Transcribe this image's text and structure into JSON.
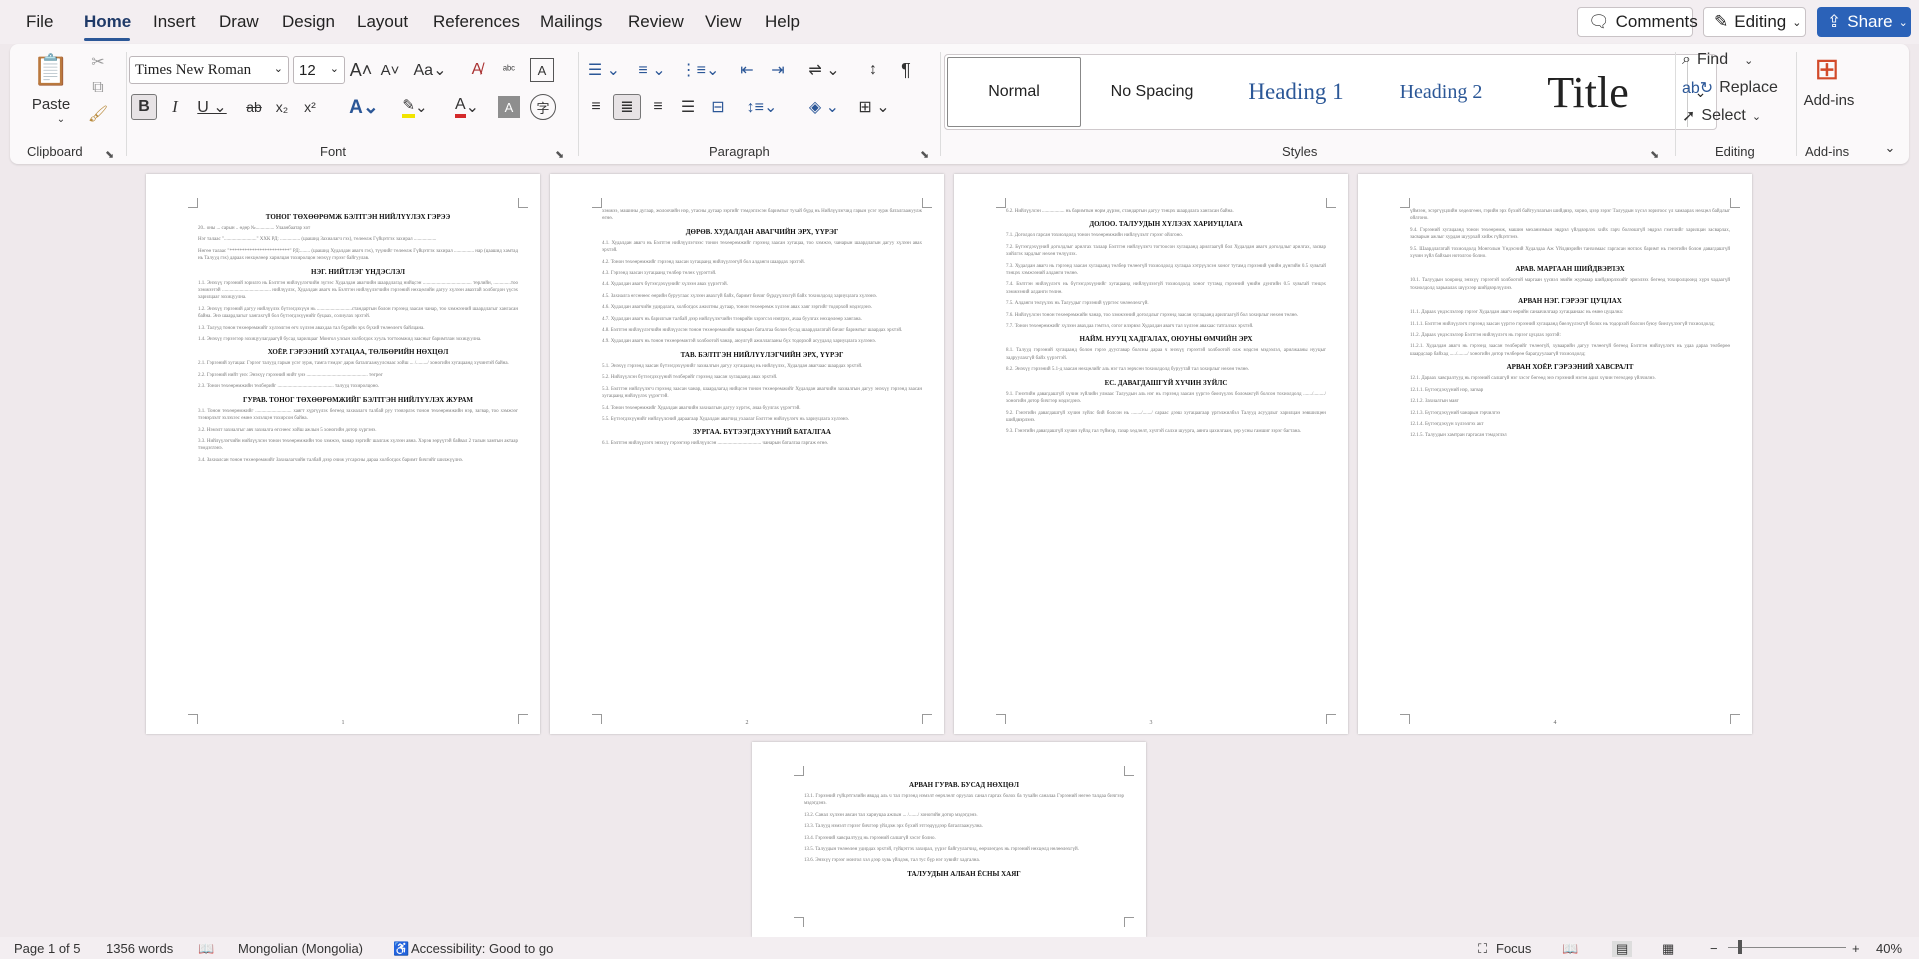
{
  "menu": {
    "tabs": [
      "File",
      "Home",
      "Insert",
      "Draw",
      "Design",
      "Layout",
      "References",
      "Mailings",
      "Review",
      "View",
      "Help"
    ],
    "active": "Home"
  },
  "topright": {
    "comments": "Comments",
    "editing": "Editing",
    "share": "Share"
  },
  "ribbon": {
    "clipboard": {
      "label": "Clipboard",
      "paste": "Paste"
    },
    "font": {
      "label": "Font",
      "name": "Times New Roman",
      "size": "12"
    },
    "paragraph": {
      "label": "Paragraph"
    },
    "styles": {
      "label": "Styles",
      "items": [
        "Normal",
        "No Spacing",
        "Heading 1",
        "Heading 2",
        "Title"
      ]
    },
    "editing": {
      "label": "Editing",
      "find": "Find",
      "replace": "Replace",
      "select": "Select"
    },
    "addins": {
      "label": "Add-ins",
      "button": "Add-ins"
    }
  },
  "pages": [
    {
      "num": "1",
      "blocks": [
        {
          "t": "h",
          "v": "ТОНОГ ТӨХӨӨРӨМЖ БЭЛТГЭН НИЙЛҮҮЛЭХ ГЭРЭЭ"
        },
        {
          "t": "p",
          "v": "20.. оны ... сарын .. өдөр                    №...............                                          Улаанбаатар хот"
        },
        {
          "t": "p",
          "v": "Нэг талаас \"..........................\" ХХК РД: ................ (цаашид Захиалагч гэх), төлөөлж Гүйцэтгэх захирал .................."
        },
        {
          "t": "p",
          "v": "Нөгөө талаас \"************************\" РД:........ (цаашид Худалдан авагч гэх), түүнийг төлөөлж Гүйцэтгэх захирал ................ нар (цаашид хамтад нь Талууд гэх) дараах нөхцөлөөр харилцан тохиролцон энэхүү гэрээг байгуулав."
        },
        {
          "t": "h",
          "v": "НЭГ. НИЙТЛЭГ ҮНДЭСЛЭЛ"
        },
        {
          "t": "p",
          "v": "1.1. Энэхүү гэрээний зорилго нь Бэлтгэн нийлүүлэгчийн зүгээс Худалдан авагчийн шаардлагад нийцсэн ....................................... төрлийн, ..............тоо хэмжээтэй ....................................... нийлүүлэх, Худалдан авагч нь Бэлтгэн нийлүүлэгчийн гэрээний нөхцөлийн дагуу хүлээн авахтай холбогдон үүсэх харилцааг зохицуулна."
        },
        {
          "t": "p",
          "v": "1.2. Энэхүү гэрээний дагуу нийлүүлэх бүтээгдэхүүн нь ............................стандартын болон гэрээнд заасан чанар, тоо хэмжээний шаардлагыг хангасан байна. Энэ шаардлагыг хангахгүй бол бүтээгдэхүүнийг буцаах, солиулах эрхтэй."
        },
        {
          "t": "p",
          "v": "1.3. Талууд тонон төхөөрөмжийг хүлээлгэн өгч хүлээн авахдаа тал бүрийн эрх бүхий төлөөлөгч байлцана."
        },
        {
          "t": "p",
          "v": "1.4. Энэхүү гэрээгээр зохицуулагдаагүй бусад харилцааг Монгол улсын холбогдох хууль тогтоомжид заасныг баримтлан зохицуулна."
        },
        {
          "t": "h",
          "v": "ХОЁР. ГЭРЭЭНИЙ ХУГАЦАА, ТӨЛБӨРИЙН НӨХЦӨЛ"
        },
        {
          "t": "p",
          "v": "2.1. Гэрээний хугацаа: Гэрээг талууд гарын үсэг зурж, тамга тэмдэг дарж баталгаажуулснаас хойш ... /........./ хоногийн хугацаанд хүчинтэй байна."
        },
        {
          "t": "p",
          "v": "2.2. Гэрээний нийт үнэ: Энэхүү гэрээний нийт үнэ ................................................. төгрөг"
        },
        {
          "t": "p",
          "v": "2.3. Тонон төхөөрөмжийн төлбөрийг ............................................. талууд тохиролцоно."
        },
        {
          "t": "h",
          "v": "ГУРАВ. ТОНОГ ТӨХӨӨРӨМЖИЙГ БЭЛТГЭН НИЙЛҮҮЛЭХ ЖУРАМ"
        },
        {
          "t": "p",
          "v": "3.1. Тонон төхөөрөмжийг ............................. хаягт хүргүүлэх бөгөөд захиалагч талбай руу тээвэрлэх тонон төхөөрөмжийн нэр, загвар, тоо хэмжээг тээвэрлэлт эхлэхээс өмнө хэлэлцэн тохирсон байна."
        },
        {
          "t": "p",
          "v": "3.2. Нэмэлт захиалгыг авч захиалга өгснөөс хойш ажлын 5 хоногийн дотор хүргэнэ."
        },
        {
          "t": "p",
          "v": "3.3. Нийлүүлэгчийн нийлүүлсэн тонон төхөөрөмжийн тоо хэмжээ, чанар зэргийг шалгаж хүлээн авна. Хэрэв зөрүүтэй байвал 2 талын хамтын актаар тэмдэглэнэ."
        },
        {
          "t": "p",
          "v": "3.4. Захиалсан тонон төхөөрөмжийг Захиалагчийн талбай дээр очиж угсарсны дараа холбогдох баримт бичгийг шилжүүлнэ."
        }
      ]
    },
    {
      "num": "2",
      "blocks": [
        {
          "t": "p",
          "v": "хэмжээ, машины дугаар, жолоочийн нэр, утасны дугаар зэргийг тэмдэглэсэн баримтыг тухай бүрд нь Нийлүүлэгчид гарын үсэг зурж баталгаажуулж өгнө."
        },
        {
          "t": "h",
          "v": "ДӨРӨВ. ХУДАЛДАН АВАГЧИЙН ЭРХ, ҮҮРЭГ"
        },
        {
          "t": "p",
          "v": "4.1. Худалдан авагч нь Бэлтгэн нийлүүлэгчээс тонон төхөөрөмжийг гэрээнд заасан хугацаа, тоо хэмжээ, чанарын шаардлагын дагуу хүлээн авах эрхтэй."
        },
        {
          "t": "p",
          "v": "4.2. Тонон төхөөрөмжийг гэрээнд заасан хугацаанд нийлүүлээгүй бол алданги шаардах эрхтэй."
        },
        {
          "t": "p",
          "v": "4.3. Гэрээнд заасан хугацаанд төлбөр төлөх үүрэгтэй."
        },
        {
          "t": "p",
          "v": "4.4. Худалдан авагч бүтээгдэхүүнийг хүлээн авах үүрэгтэй."
        },
        {
          "t": "p",
          "v": "4.5. Захиалга өгсөнөөс өөрийн буруугаас хүлээн авахгүй байх, баримт бичиг бүрдүүлэхгүй байх тохиолдолд хариуцлага хүлээнэ."
        },
        {
          "t": "p",
          "v": "4.6. Худалдан авагчийн удирдлага, холбогдох ажилтны дугаар, тонон төхөөрөмж хүлээн авах хаяг зэргийг тодорхой мэдэгдэнэ."
        },
        {
          "t": "p",
          "v": "4.7. Худалдан авагч нь барилгын талбай дээр нийлүүлэгчийн тээврийн хэрэгсэл нэвтрэх, ачаа буулгах нөхцөлөөр хангана."
        },
        {
          "t": "p",
          "v": "4.8. Бэлтгэн нийлүүлэгчийн нийлүүлсэн тонон төхөөрөмжийн чанарын баталгаа болон бусад шаардлагатай бичиг баримтыг шаардах эрхтэй."
        },
        {
          "t": "p",
          "v": "4.9. Худалдан авагч нь тонон төхөөрөмжтэй холбоотой чанар, аюулгүй ажиллагааны бүх тодорхой асуудалд хариуцлага хүлээнэ."
        },
        {
          "t": "h",
          "v": "ТАВ. БЭЛТГЭН НИЙЛҮҮЛЭГЧИЙН ЭРХ, ҮҮРЭГ"
        },
        {
          "t": "p",
          "v": "5.1. Энэхүү гэрээнд заасан бүтээгдэхүүнийг захиалгын дагуу хугацаанд нь нийлүүлэх, Худалдан авагчаас шаардах эрхтэй."
        },
        {
          "t": "p",
          "v": "5.2. Нийлүүлсэн бүтээгдэхүүний төлбөрийг гэрээнд заасан хугацаанд авах эрхтэй."
        },
        {
          "t": "p",
          "v": "5.3. Бэлтгэн нийлүүлэгч гэрээнд заасан чанар, шаардлагад нийцсэн тонон төхөөрөмжийг Худалдан авагчийн захиалгын дагуу энэхүү гэрээнд заасан хугацаанд нийлүүлэх үүрэгтэй."
        },
        {
          "t": "p",
          "v": "5.4. Тонон төхөөрөмжийг Худалдан авагчийн захиалгын дагуу хүргэх, ачаа буулгах үүрэгтэй."
        },
        {
          "t": "p",
          "v": "5.5. Бүтээгдэхүүнийг нийлүүлсний дараагаар Худалдан авагчид ухаалаг Бэлтгэн нийлүүлэгч нь хариуцлага хүлээнэ."
        },
        {
          "t": "h",
          "v": "ЗУРГАА. БҮТЭЭГДЭХҮҮНИЙ БАТАЛГАА"
        },
        {
          "t": "p",
          "v": "6.1. Бэлтгэн нийлүүлэгч энэхүү гэрээгээр нийлүүлсэн ................................... чанарын баталгаа гаргаж өгнө."
        }
      ]
    },
    {
      "num": "3",
      "blocks": [
        {
          "t": "p",
          "v": "6.2. Нийлүүлсэн .................. нь баримтын норм дүрэм, стандартын дагуу тэнцэх шаардлага хангасан байна."
        },
        {
          "t": "h",
          "v": "ДОЛОО. ТАЛУУДЫН ХҮЛЭЭХ ХАРИУЦЛАГА"
        },
        {
          "t": "p",
          "v": "7.1. Доголдол гарсан тохиолдолд тонон төхөөрөмжийн нийлүүлэлт гэрээг ойлгоно."
        },
        {
          "t": "p",
          "v": "7.2. Бүтээгдэхүүний доголдлыг арилгах талаар Бэлтгэн нийлүүлэгч тогтоосон хугацаанд арилгаагүй бол Худалдан авагч доголдлыг арилгах, засвар хийлгэх зардлыг нөхөн төлүүлэх."
        },
        {
          "t": "p",
          "v": "7.3. Худалдан авагч нь гэрээнд заасан хугацаанд төлбөр төлөөгүй тохиолдолд хугацаа хэтрүүлсэн хоног тутамд гэрээний үнийн дүнгийн 0.5 хувьтай тэнцэх хэмжээний алданги төлнө."
        },
        {
          "t": "p",
          "v": "7.4. Бэлтгэн нийлүүлэгч нь бүтээгдэхүүнийг хугацаанд нийлүүлээгүй тохиолдолд хоног тутамд гэрээний үнийн дүнгийн 0.5 хувьтай тэнцэх хэмжээний алданги төлнө."
        },
        {
          "t": "p",
          "v": "7.5. Алданги төлүүлэх нь Талуудыг гэрээний үүргээс чөлөөлөхгүй."
        },
        {
          "t": "p",
          "v": "7.6. Нийлүүлсэн тонон төхөөрөмжийн чанар, тоо хэмжээний доголдлыг гэрээнд заасан хугацаанд арилгаагүй бол хохирлыг нөхөн төлнө."
        },
        {
          "t": "p",
          "v": "7.7. Тонон төхөөрөмжийг хүлээн авахдаа гэмтэл, согог илэрвэл Худалдан авагч тал хүлээн авахаас татгалзах эрхтэй."
        },
        {
          "t": "h",
          "v": "НАЙМ. НУУЦ ХАДГАЛАХ, ОЮУНЫ ӨМЧИЙН ЭРХ"
        },
        {
          "t": "p",
          "v": "8.1. Талууд гэрээний хугацаанд болон гэрээ дуусгавар болсны дараа ч энэхүү гэрээтэй холбоотой олж мэдсэн мэдээлэл, арилжааны нууцыг задруулахгүй байх үүрэгтэй."
        },
        {
          "t": "p",
          "v": "8.2. Энэхүү гэрээний 5.1-д заасан нөхцөлийг аль нэг тал зөрчсөн тохиолдолд буруутай тал хохирлыг нөхөн төлнө."
        },
        {
          "t": "h",
          "v": "ЕС. ДАВАГДАШГҮЙ ХҮЧИН ЗҮЙЛС"
        },
        {
          "t": "p",
          "v": "9.1. Гэнэтийн давагдашгүй хүчин зүйлийн улмаас Талуудын аль нэг нь гэрээнд заасан үүргээ биелүүлэх боломжгүй болсон тохиолдолд ......./........./ хоногийн дотор бичгээр мэдэгдэнэ."
        },
        {
          "t": "p",
          "v": "9.2. Гэнэтийн давагдашгүй хүчин зүйлс бий болсон нь ......../......./ сараас дээш хугацаагаар үргэлжилбэл Талууд асуудлыг харилцан зөвшилцөн шийдвэрлэнэ."
        },
        {
          "t": "p",
          "v": "9.3. Гэнэтийн давагдашгүй хүчин зүйлд гал түймэр, газар хөдлөлт, хүчтэй салхи шуурга, аянга цахилгаан, үер усны гамшиг зэрэг багтана."
        }
      ]
    },
    {
      "num": "4",
      "blocks": [
        {
          "t": "p",
          "v": "үймээн, эсэргүүцлийн хөдөлгөөн, гэрийн эрх бүхий байгууллагын шийдвэр, хорио, цээр зэрэг Талуудын хүсэл зоригоос үл хамаарах нөхцөл байдлыг ойлгоно."
        },
        {
          "t": "p",
          "v": "9.4. Гэрээний хугацаанд тонон төхөөрөмж, машин механизмын эвдрэл үйлдвэрлэх хийх гарч болзошгүй эвдрэл гэмтлийг харилцан засварлах, засварын ажлыг хурдан шуурхай хийж гүйцэтгэнэ."
        },
        {
          "t": "p",
          "v": "9.5. Шаардлагатай тохиолдолд Монголын Үндэсний Худалдаа Аж Үйлдвэрийн танхимаас гаргасан нотлох баримт нь гэнэтийн болон давагдашгүй хүчин зүйл байхын нотолгоо болно."
        },
        {
          "t": "h",
          "v": "АРАВ. МАРГААН ШИЙДВЭРЛЭХ"
        },
        {
          "t": "p",
          "v": "10.1. Талуудын хооронд энэхүү гэрээтэй холбоотой маргаан үүсвэл эвийн журмаар шийдвэрлэхийг эрмэлзэх бөгөөд тохиролцоонд хүрч чадаагүй тохиолдолд харьяалах шүүхээр шийдвэрлүүлнэ."
        },
        {
          "t": "h",
          "v": "АРВАН НЭГ. ГЭРЭЭГ ЦУЦЛАХ"
        },
        {
          "t": "p",
          "v": "11.1. Дараах үндэслэлээр гэрээг Худалдан авагч өөрийн санаачилгаар хугацаанаас нь өмнө цуцална:"
        },
        {
          "t": "p",
          "v": "11.1.1. Бэлтгэн нийлүүлэгч гэрээнд заасан үүргээ гэрээний хугацаанд биелүүлэхгүй болох нь тодорхой болсон буюу биелүүлээгүй тохиолдолд;"
        },
        {
          "t": "p",
          "v": "11.2. Дараах үндэслэлээр Бэлтгэн нийлүүлэгч нь гэрээг цуцлах эрхтэй:"
        },
        {
          "t": "p",
          "v": "11.2.1. Худалдан авагч нь гэрээнд заасан төлбөрийг төлөөгүй, хуваарийн дагуу төлөөгүй бөгөөд Бэлтгэн нийлүүлэгч нь удаа дараа төлбөрөө шаардсаар байхад ...../......../ хоногийн дотор төлбөрөө барагдуулаагүй тохиолдолд;"
        },
        {
          "t": "h",
          "v": "АРВАН ХОЁР. ГЭРЭЭНИЙ ХАВСРАЛТ"
        },
        {
          "t": "p",
          "v": "12.1. Дараах хавсралтууд нь гэрээний салшгүй нэг хэсэг бөгөөд энэ гэрээний нэгэн адил хүчин төгөлдөр үйлчилнэ."
        },
        {
          "t": "p",
          "v": "12.1.1. Бүтээгдэхүүний нэр, загвар"
        },
        {
          "t": "p",
          "v": "12.1.2. Захиалгын маяг"
        },
        {
          "t": "p",
          "v": "12.1.3. Бүтээгдэхүүний чанарын гэрчилгээ"
        },
        {
          "t": "p",
          "v": "12.1.4. Бүтээгдэхүүн хүлээлгэх акт"
        },
        {
          "t": "p",
          "v": "12.1.5. Талуудын хамтран гаргасан тэмдэглэл"
        }
      ]
    },
    {
      "num": "5",
      "blocks": [
        {
          "t": "h",
          "v": "АРВАН ГУРАВ. БУСАД НӨХЦӨЛ"
        },
        {
          "t": "p",
          "v": "13.1. Гэрээний гүйцэтгэлийн явцад аль ч тал гэрээнд нэмэлт өөрчлөлт оруулах санал гаргах болох ба тухайн саналаа Гэрээний нөгөө талдаа бичгээр мэдэгдэнэ."
        },
        {
          "t": "p",
          "v": "13.2. Санал хүлээн авсан тал хариуцаа ажлын ... /......./ хоногийн дотор мэдэгдэнэ."
        },
        {
          "t": "p",
          "v": "13.3. Талууд нэмэлт гэрээг бичгээр үйлдэж эрх бүхий этгээдүүдээр баталгаажуулна."
        },
        {
          "t": "p",
          "v": "13.4. Гэрээний хавсралтууд нь гэрээний салшгүй хэсэг болно."
        },
        {
          "t": "p",
          "v": "13.5. Талуудын төлөөлөн удирдах эрхтэй, гүйцэтгэх захирал, үүрэг байгуулагчид, өөрчлөгдөх нь гэрээний нөхцөлд нөлөөлөхгүй."
        },
        {
          "t": "p",
          "v": "13.6. Энэхүү гэрээг монгол хэл дээр хувь үйлдэж, тал тус бүр нэг хувийг хадгална."
        },
        {
          "t": "h",
          "v": "ТАЛУУДЫН АЛБАН ЁСНЫ ХАЯГ"
        }
      ]
    }
  ],
  "status": {
    "page": "Page 1 of 5",
    "words": "1356 words",
    "language": "Mongolian (Mongolia)",
    "accessibility": "Accessibility: Good to go",
    "focus": "Focus",
    "zoom": "40%"
  }
}
